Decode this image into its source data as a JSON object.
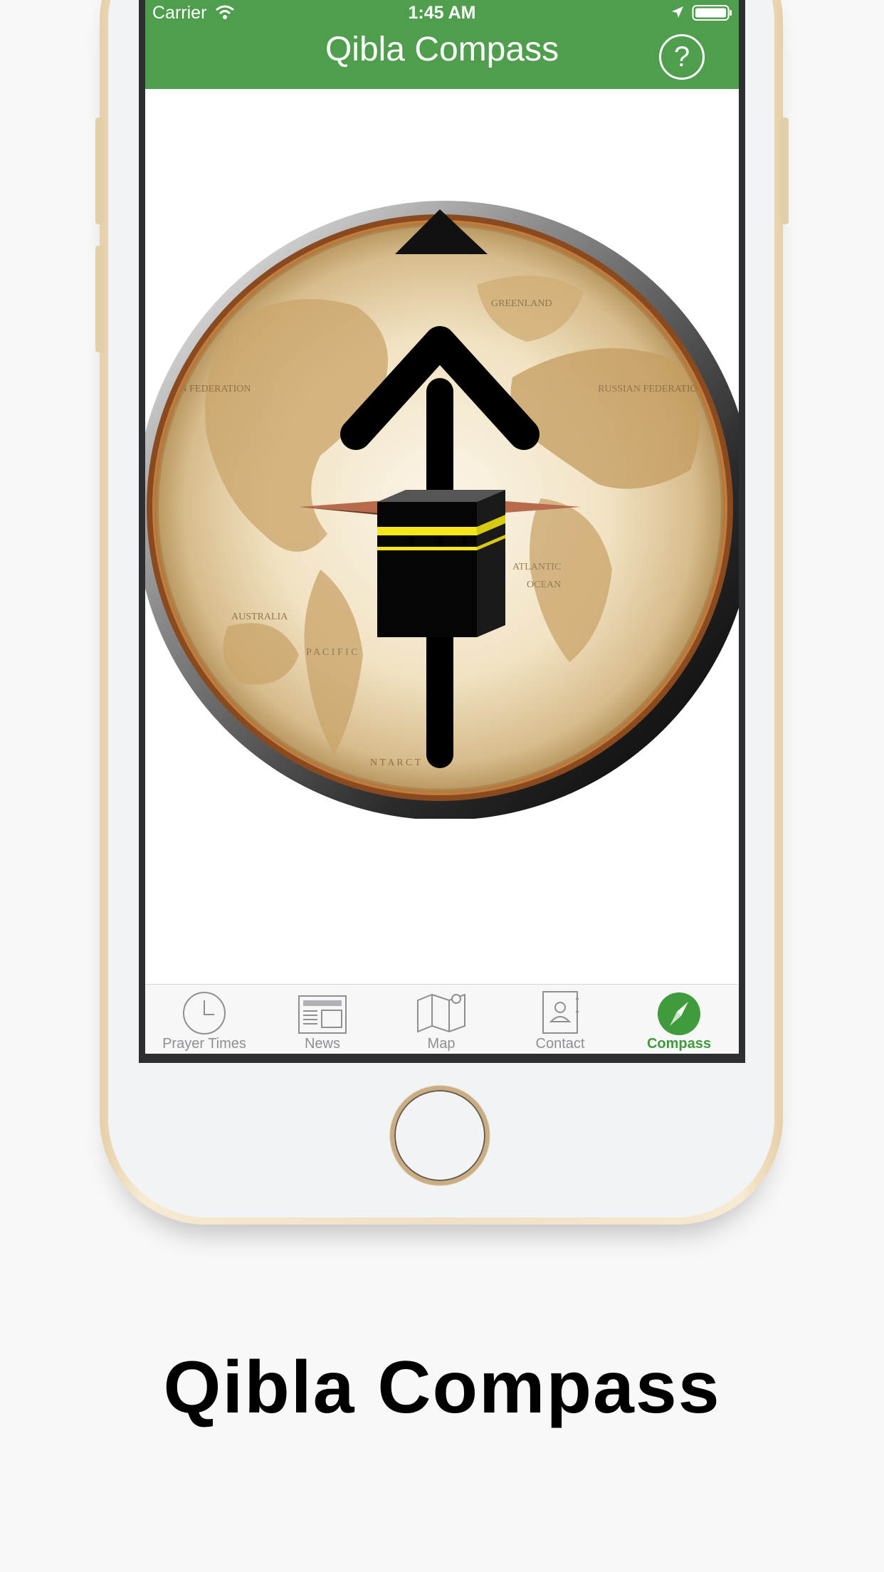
{
  "status_bar": {
    "carrier": "Carrier",
    "time": "1:45 AM"
  },
  "nav": {
    "title": "Qibla Compass",
    "help_label": "?"
  },
  "compass": {
    "map_labels": [
      "GREENLAND",
      "RUSSIAN FEDERATION",
      "SIAN FEDERATION",
      "ATLANTIC",
      "OCEAN",
      "AUSTRALIA",
      "P A C I F I C",
      "N T A R C T"
    ]
  },
  "tabs": [
    {
      "label": "Prayer Times",
      "icon": "clock-icon",
      "active": false
    },
    {
      "label": "News",
      "icon": "newspaper-icon",
      "active": false
    },
    {
      "label": "Map",
      "icon": "map-icon",
      "active": false
    },
    {
      "label": "Contact",
      "icon": "contact-book-icon",
      "active": false
    },
    {
      "label": "Compass",
      "icon": "compass-icon",
      "active": true
    }
  ],
  "promo": {
    "title": "Qibla Compass"
  },
  "colors": {
    "accent": "#4f9e4d",
    "active_tab": "#3f9b3b",
    "inactive_tab": "#8e8e93"
  }
}
